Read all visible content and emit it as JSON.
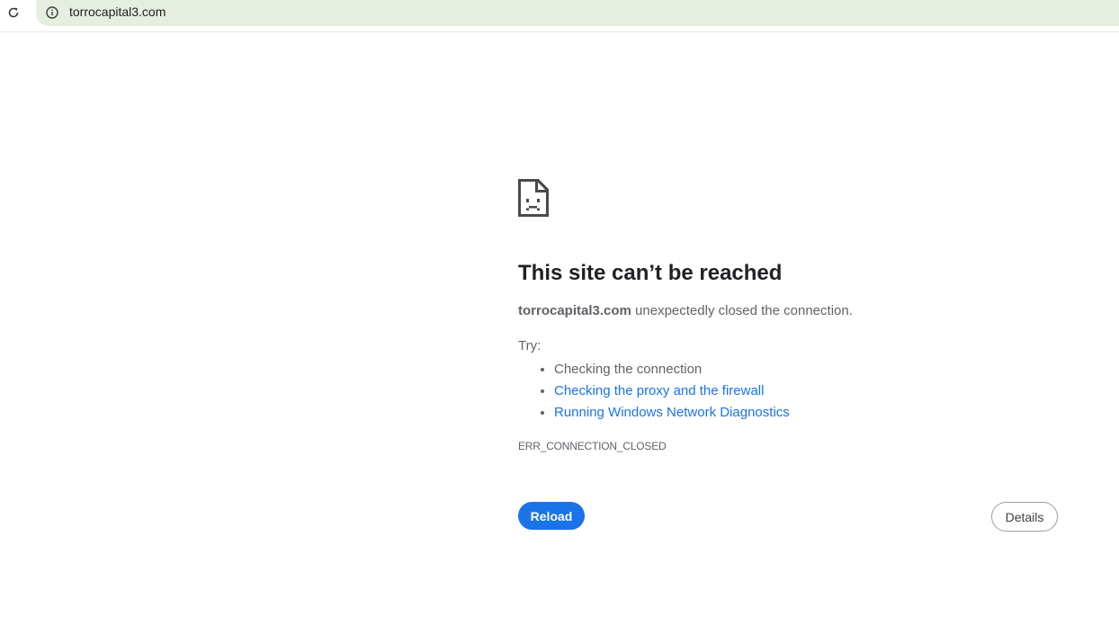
{
  "browser": {
    "address_bar": {
      "url": "torrocapital3.com",
      "info_icon": "info-icon"
    },
    "reload_icon": "reload-icon"
  },
  "error_page": {
    "icon": "sad-page-icon",
    "title": "This site can’t be reached",
    "host": "torrocapital3.com",
    "message": " unexpectedly closed the connection.",
    "try_label": "Try:",
    "suggestions": [
      "Checking the connection",
      "Checking the proxy and the firewall",
      "Running Windows Network Diagnostics"
    ],
    "error_code": "ERR_CONNECTION_CLOSED",
    "reload_button": "Reload",
    "details_button": "Details"
  },
  "colors": {
    "accent": "#1a73e8",
    "omnibox_background": "#e6eee0",
    "secondary_text": "#5f6368"
  }
}
